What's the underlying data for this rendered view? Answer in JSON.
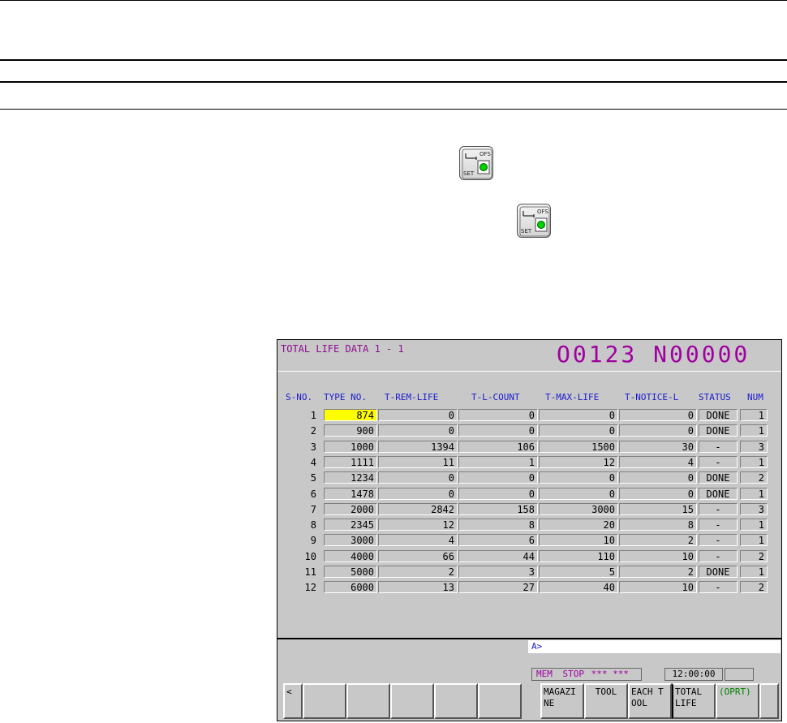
{
  "screen": {
    "title": "TOTAL LIFE DATA 1 - 1",
    "program": "O0123 N00000",
    "columns": {
      "sno": "S-NO.",
      "type": "TYPE NO.",
      "rem": "T-REM-LIFE",
      "count": "T-L-COUNT",
      "max": "T-MAX-LIFE",
      "notice": "T-NOTICE-L",
      "status": "STATUS",
      "num": "NUM"
    },
    "rows": [
      {
        "sno": "1",
        "type": "874",
        "rem": "0",
        "count": "0",
        "max": "0",
        "notice": "0",
        "status": "DONE",
        "num": "1"
      },
      {
        "sno": "2",
        "type": "900",
        "rem": "0",
        "count": "0",
        "max": "0",
        "notice": "0",
        "status": "DONE",
        "num": "1"
      },
      {
        "sno": "3",
        "type": "1000",
        "rem": "1394",
        "count": "106",
        "max": "1500",
        "notice": "30",
        "status": "-",
        "num": "3"
      },
      {
        "sno": "4",
        "type": "1111",
        "rem": "11",
        "count": "1",
        "max": "12",
        "notice": "4",
        "status": "-",
        "num": "1"
      },
      {
        "sno": "5",
        "type": "1234",
        "rem": "0",
        "count": "0",
        "max": "0",
        "notice": "0",
        "status": "DONE",
        "num": "2"
      },
      {
        "sno": "6",
        "type": "1478",
        "rem": "0",
        "count": "0",
        "max": "0",
        "notice": "0",
        "status": "DONE",
        "num": "1"
      },
      {
        "sno": "7",
        "type": "2000",
        "rem": "2842",
        "count": "158",
        "max": "3000",
        "notice": "15",
        "status": "-",
        "num": "3"
      },
      {
        "sno": "8",
        "type": "2345",
        "rem": "12",
        "count": "8",
        "max": "20",
        "notice": "8",
        "status": "-",
        "num": "1"
      },
      {
        "sno": "9",
        "type": "3000",
        "rem": "4",
        "count": "6",
        "max": "10",
        "notice": "2",
        "status": "-",
        "num": "1"
      },
      {
        "sno": "10",
        "type": "4000",
        "rem": "66",
        "count": "44",
        "max": "110",
        "notice": "10",
        "status": "-",
        "num": "2"
      },
      {
        "sno": "11",
        "type": "5000",
        "rem": "2",
        "count": "3",
        "max": "5",
        "notice": "2",
        "status": "DONE",
        "num": "1"
      },
      {
        "sno": "12",
        "type": "6000",
        "rem": "13",
        "count": "27",
        "max": "40",
        "notice": "10",
        "status": "-",
        "num": "2"
      }
    ],
    "command_prompt": "A>",
    "status_bar": {
      "mode": "MEM",
      "state": "STOP",
      "alarm": "*** ***",
      "time": "12:00:00"
    },
    "softkeys": {
      "left_arrow": "<",
      "magazine": "MAGAZINE",
      "tool": "TOOL",
      "each_tool": "EACH TOOL",
      "total_life": "TOTAL LIFE",
      "oprt": "(OPRT)"
    }
  },
  "icons": {
    "offset_setting_key_label_top": "OFS",
    "offset_setting_key_label_bottom": "SET"
  },
  "colors": {
    "screen_bg": "#c8c8c8",
    "title": "#8e0b8e",
    "program": "#a000a0",
    "headers": "#1a1ad0",
    "highlight": "#ffff00",
    "oprt": "#008000"
  }
}
